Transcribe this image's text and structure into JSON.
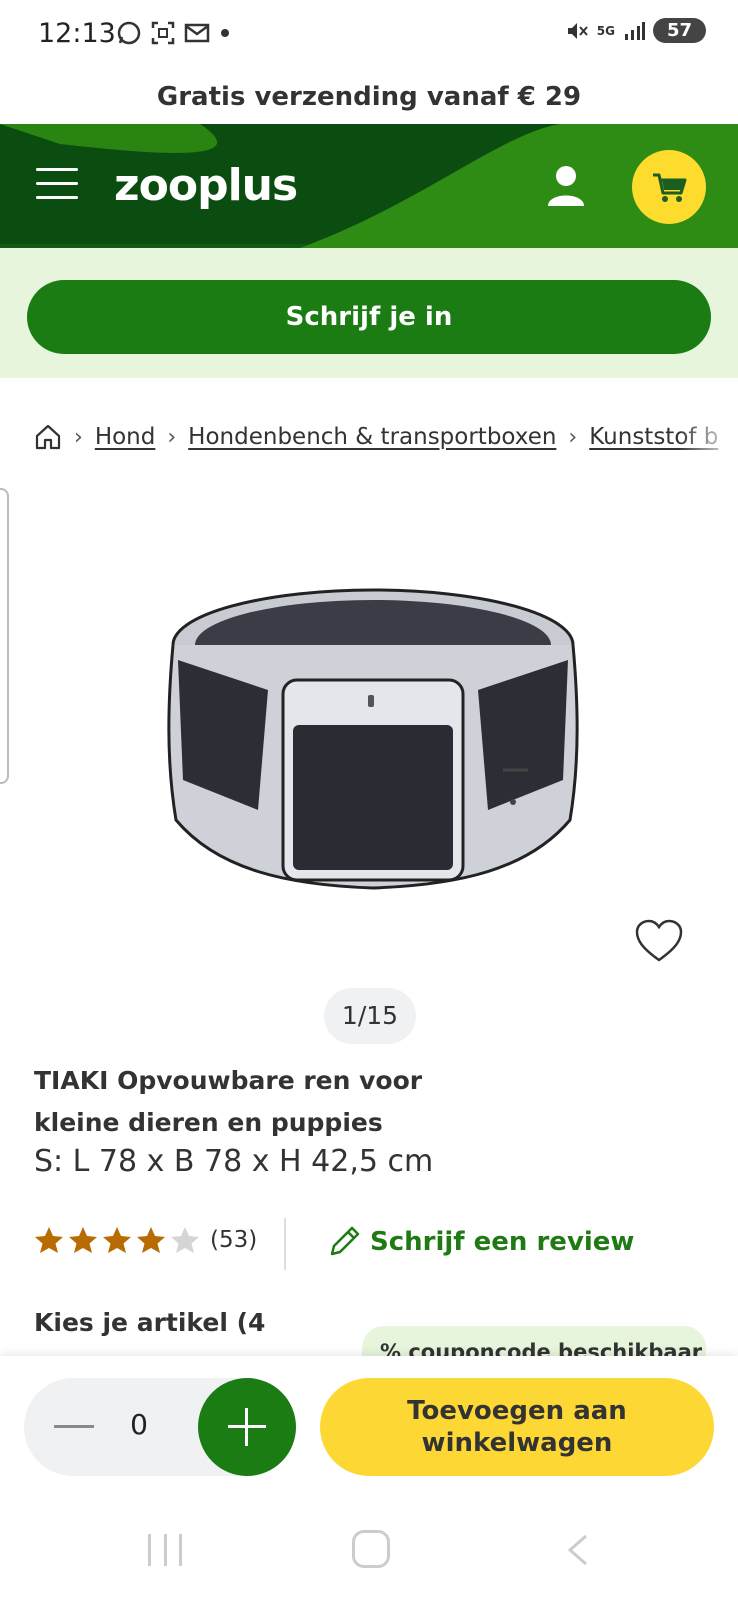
{
  "status_bar": {
    "time": "12:13",
    "battery": "57",
    "network": "5G"
  },
  "promo": {
    "text": "Gratis verzending vanaf € 29"
  },
  "header": {
    "logo": "zooplus",
    "colors": {
      "dark_green": "#0f5b14",
      "green": "#2e8b13",
      "cart_yellow": "#fddc2e"
    }
  },
  "signup": {
    "label": "Schrijf je in"
  },
  "breadcrumb": {
    "items": [
      "Hond",
      "Hondenbench & transportboxen",
      "Kunststof b"
    ]
  },
  "gallery": {
    "counter": "1/15"
  },
  "product": {
    "title": "TIAKI Opvouwbare ren voor kleine dieren en puppies",
    "variant": "S: L 78 x B 78 x H 42,5 cm",
    "rating_value": 4,
    "rating_max": 5,
    "review_count": "(53)",
    "write_review": "Schrijf een review",
    "choose_label": "Kies je artikel (4",
    "coupon": "% couponcode beschikbaar"
  },
  "cart_bar": {
    "quantity": "0",
    "add_label": "Toevoegen aan winkelwagen"
  }
}
